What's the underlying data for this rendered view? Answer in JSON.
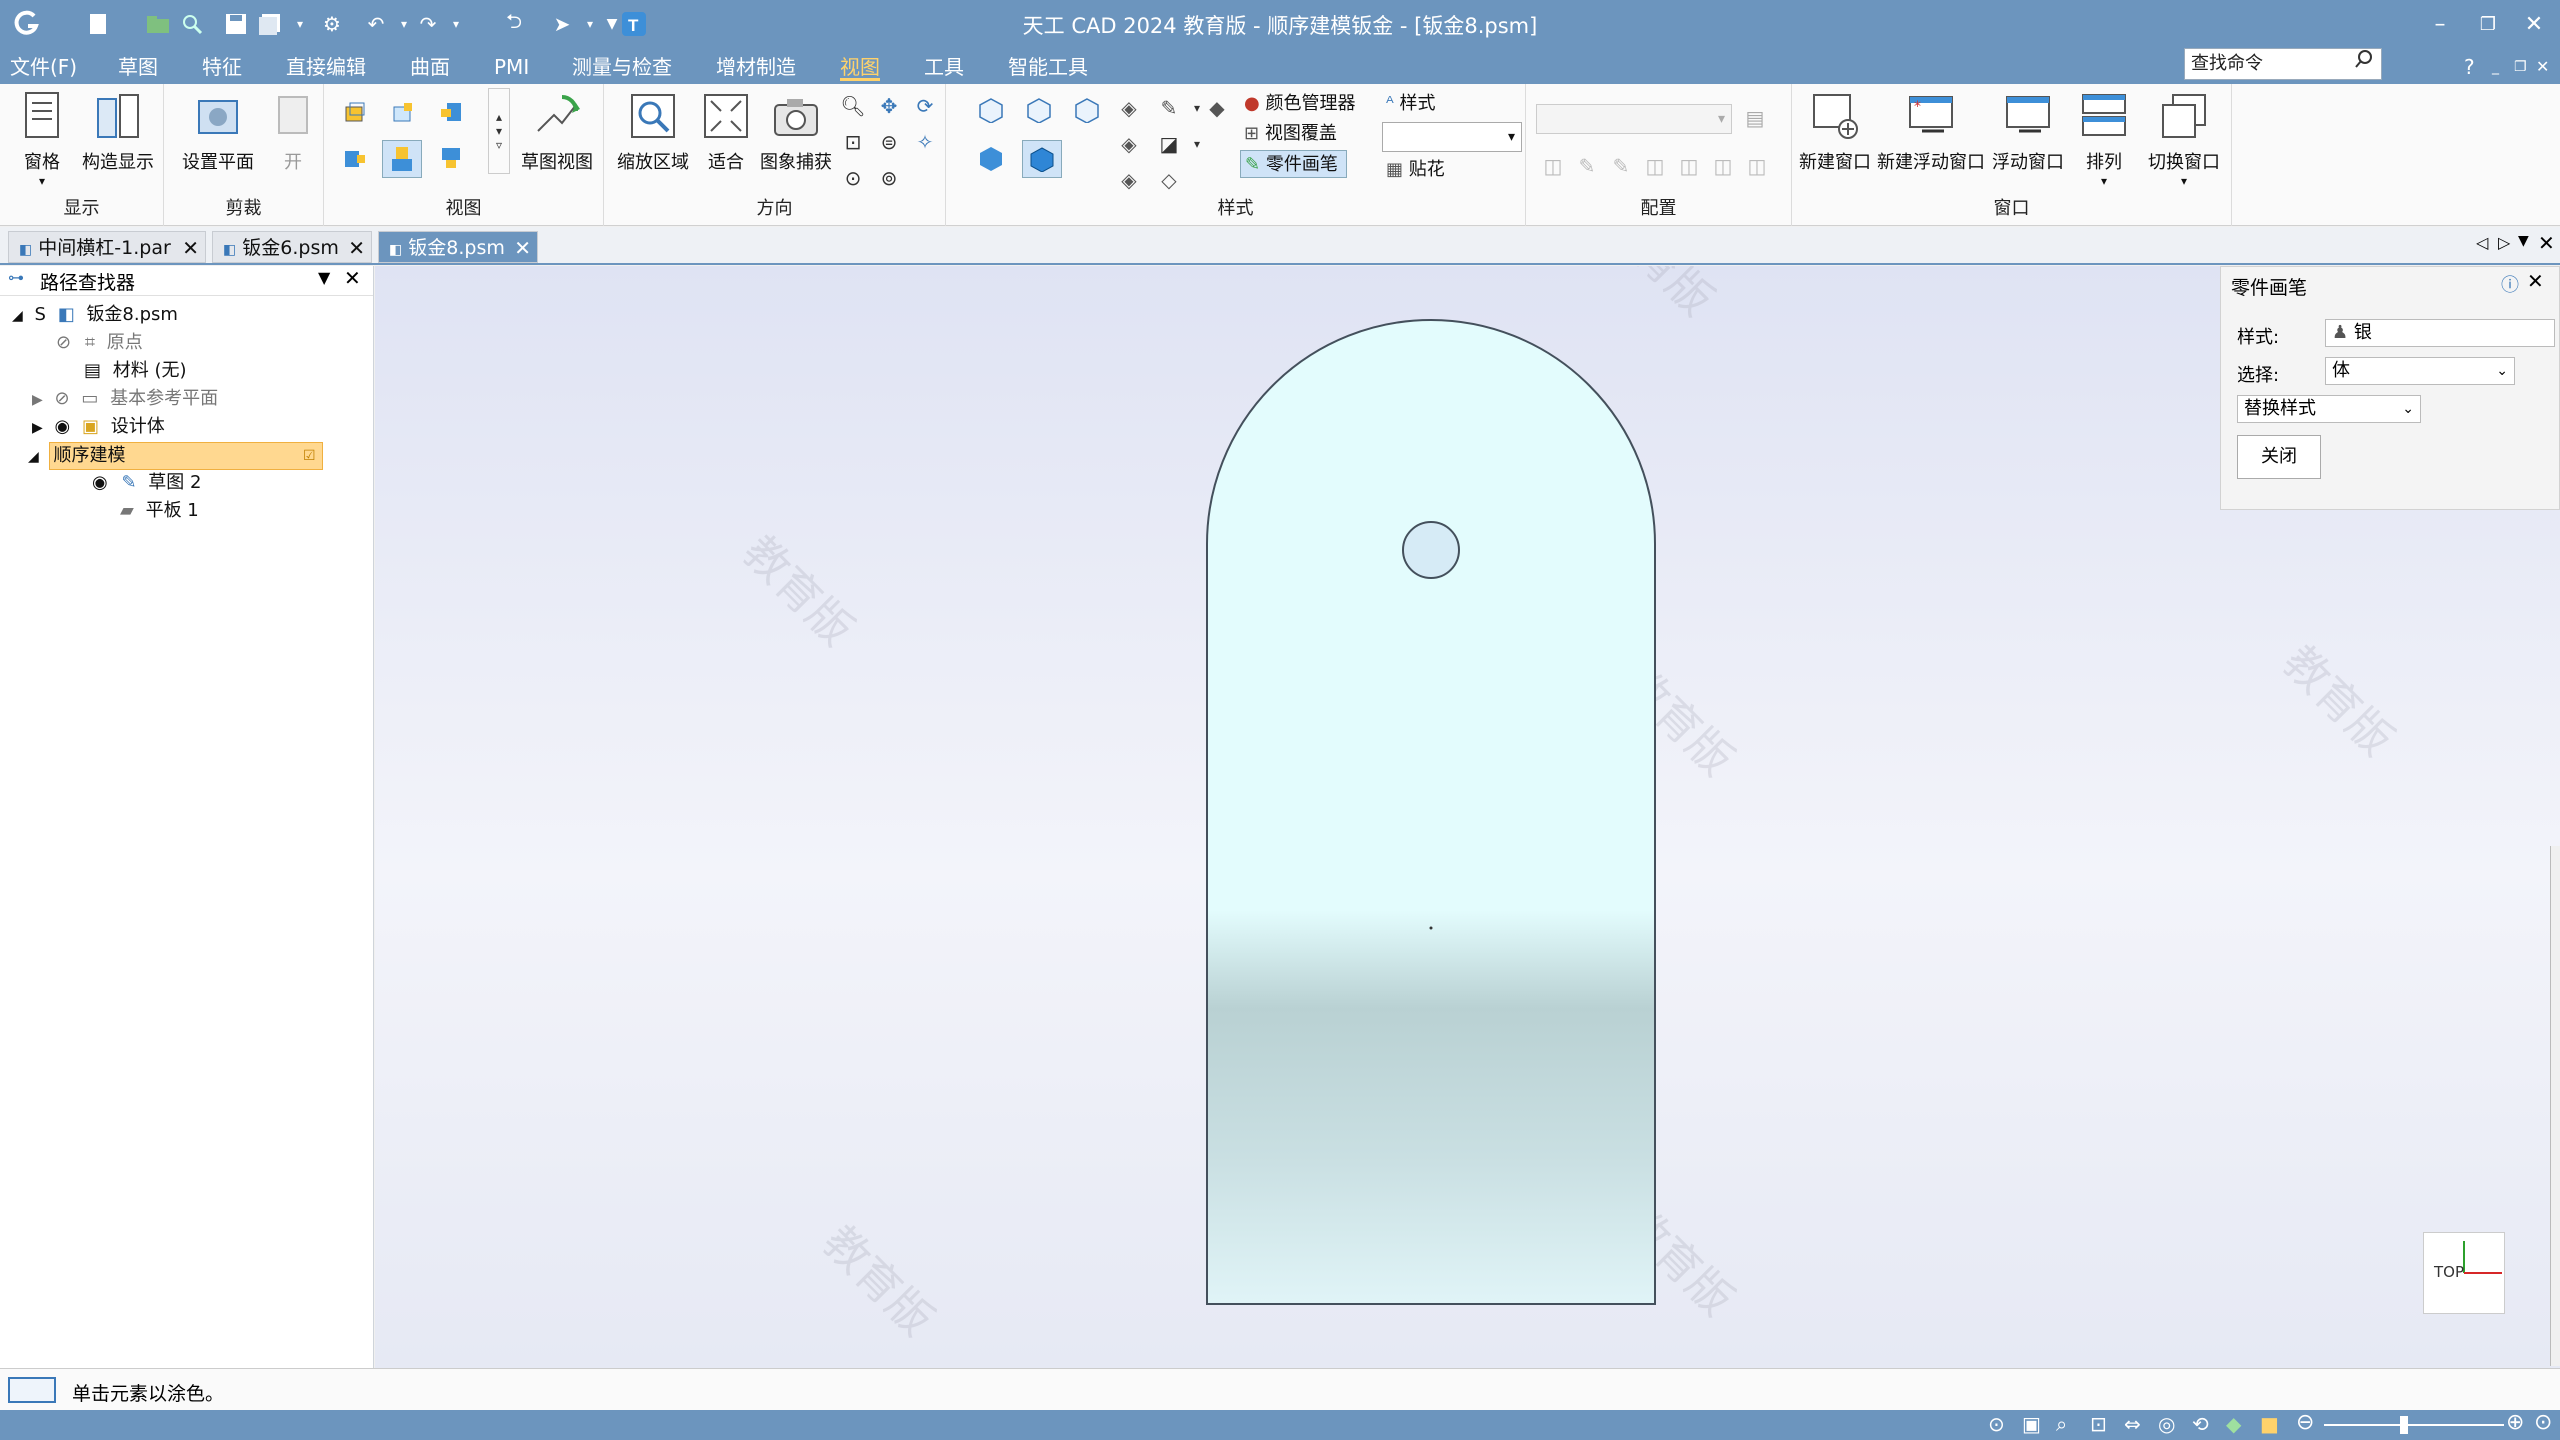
{
  "app": {
    "title": "天工 CAD 2024 教育版 - 顺序建模钣金 - [钣金8.psm]"
  },
  "menu": [
    "文件(F)",
    "草图",
    "特征",
    "直接编辑",
    "曲面",
    "PMI",
    "测量与检查",
    "增材制造",
    "视图",
    "工具",
    "智能工具"
  ],
  "search": {
    "placeholder": "查找命令"
  },
  "help": "?",
  "ribbon": {
    "display": {
      "label": "显示",
      "btn1": "窗格",
      "btn2": "构造显示"
    },
    "clip": {
      "label": "剪裁",
      "btn1": "设置平面",
      "btn2": "开"
    },
    "view": {
      "label": "视图",
      "btn1": "草图视图"
    },
    "orient": {
      "label": "方向",
      "btn1": "缩放区域",
      "btn2": "适合",
      "btn3": "图象捕获"
    },
    "style": {
      "label": "样式",
      "color_mgr": "颜色管理器",
      "view_overlay": "视图覆盖",
      "part_painter": "零件画笔",
      "style": "样式",
      "decal": "贴花"
    },
    "config": {
      "label": "配置"
    },
    "window": {
      "label": "窗口",
      "btn1": "新建窗口",
      "btn2": "新建浮动窗口",
      "btn3": "浮动窗口",
      "btn4": "排列",
      "btn5": "切换窗口"
    }
  },
  "tabs": [
    {
      "label": "中间横杠-1.par"
    },
    {
      "label": "钣金6.psm"
    },
    {
      "label": "钣金8.psm"
    }
  ],
  "pathfinder": {
    "title": "路径查找器",
    "items": [
      {
        "label": "钣金8.psm"
      },
      {
        "label": "原点"
      },
      {
        "label": "材料 (无)"
      },
      {
        "label": "基本参考平面"
      },
      {
        "label": "设计体"
      },
      {
        "label": "顺序建模"
      },
      {
        "label": "草图 2"
      },
      {
        "label": "平板 1"
      }
    ]
  },
  "watermark": "教育版",
  "viewcube": {
    "label": "TOP"
  },
  "panel": {
    "title": "零件画笔",
    "style_label": "样式:",
    "style_value": "银",
    "select_label": "选择:",
    "select_value": "体",
    "replace_style": "替换样式",
    "close": "关闭"
  },
  "status": {
    "prompt": "单击元素以涂色。"
  },
  "colors": {
    "accent": "#6c95be",
    "highlight": "#ffd26b",
    "tree_sel": "#ffd890"
  }
}
